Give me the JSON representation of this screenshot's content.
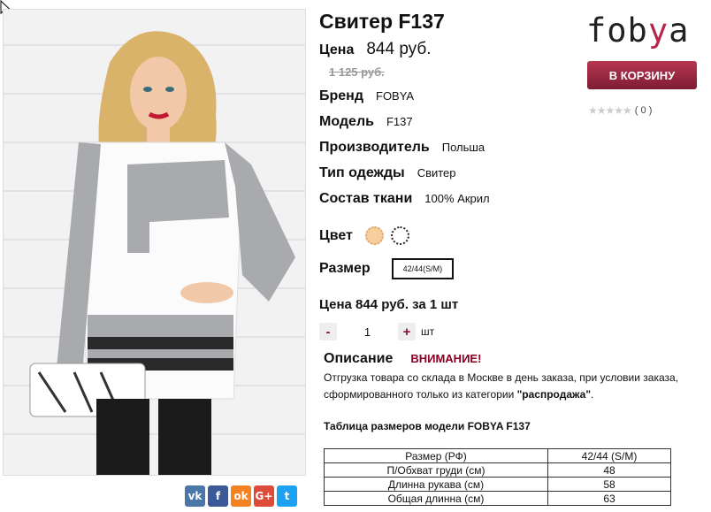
{
  "product": {
    "title": "Свитер F137",
    "price_label": "Цена",
    "price": "844 руб.",
    "old_price": "1 125 руб."
  },
  "attributes": [
    {
      "key": "Бренд",
      "value": "FOBYA"
    },
    {
      "key": "Модель",
      "value": "F137"
    },
    {
      "key": "Производитель",
      "value": "Польша"
    },
    {
      "key": "Тип одежды",
      "value": "Свитер"
    },
    {
      "key": "Состав ткани",
      "value": "100% Акрил"
    }
  ],
  "color": {
    "label": "Цвет",
    "swatches": [
      "#f7cf9c",
      "#ffffff"
    ]
  },
  "size": {
    "label": "Размер",
    "selected": "42/44(S/M)"
  },
  "unit_price": "Цена 844 руб. за 1 шт",
  "quantity": {
    "minus": "-",
    "value": "1",
    "plus": "+",
    "unit": "шт"
  },
  "description": {
    "heading": "Описание",
    "warning": "ВНИМАНИЕ!",
    "text_before": "Отгрузка товара со склада в Москве в день заказа, при условии заказа, сформированного только из категории ",
    "text_bold": "\"распродажа\"",
    "text_after": "."
  },
  "size_table": {
    "title": "Таблица размеров модели FOBYA F137",
    "headers": [
      "Размер (РФ)",
      "42/44 (S/M)"
    ],
    "rows": [
      [
        "П/Обхват груди (см)",
        "48"
      ],
      [
        "Длинна рукава (см)",
        "58"
      ],
      [
        "Общая длинна (см)",
        "63"
      ]
    ]
  },
  "brand_logo": {
    "part1": "fob",
    "part2": "y",
    "part3": "a"
  },
  "cart_button": "В КОРЗИНУ",
  "rating": {
    "stars": "★★★★★",
    "count": "( 0 )"
  },
  "share": [
    {
      "icon": "vk-icon",
      "glyph": "vk",
      "color": "#4a76a8"
    },
    {
      "icon": "facebook-icon",
      "glyph": "f",
      "color": "#3b5998"
    },
    {
      "icon": "odnoklassniki-icon",
      "glyph": "ok",
      "color": "#f58220"
    },
    {
      "icon": "google-plus-icon",
      "glyph": "G+",
      "color": "#dd4b39"
    },
    {
      "icon": "twitter-icon",
      "glyph": "t",
      "color": "#1da1f2"
    }
  ]
}
